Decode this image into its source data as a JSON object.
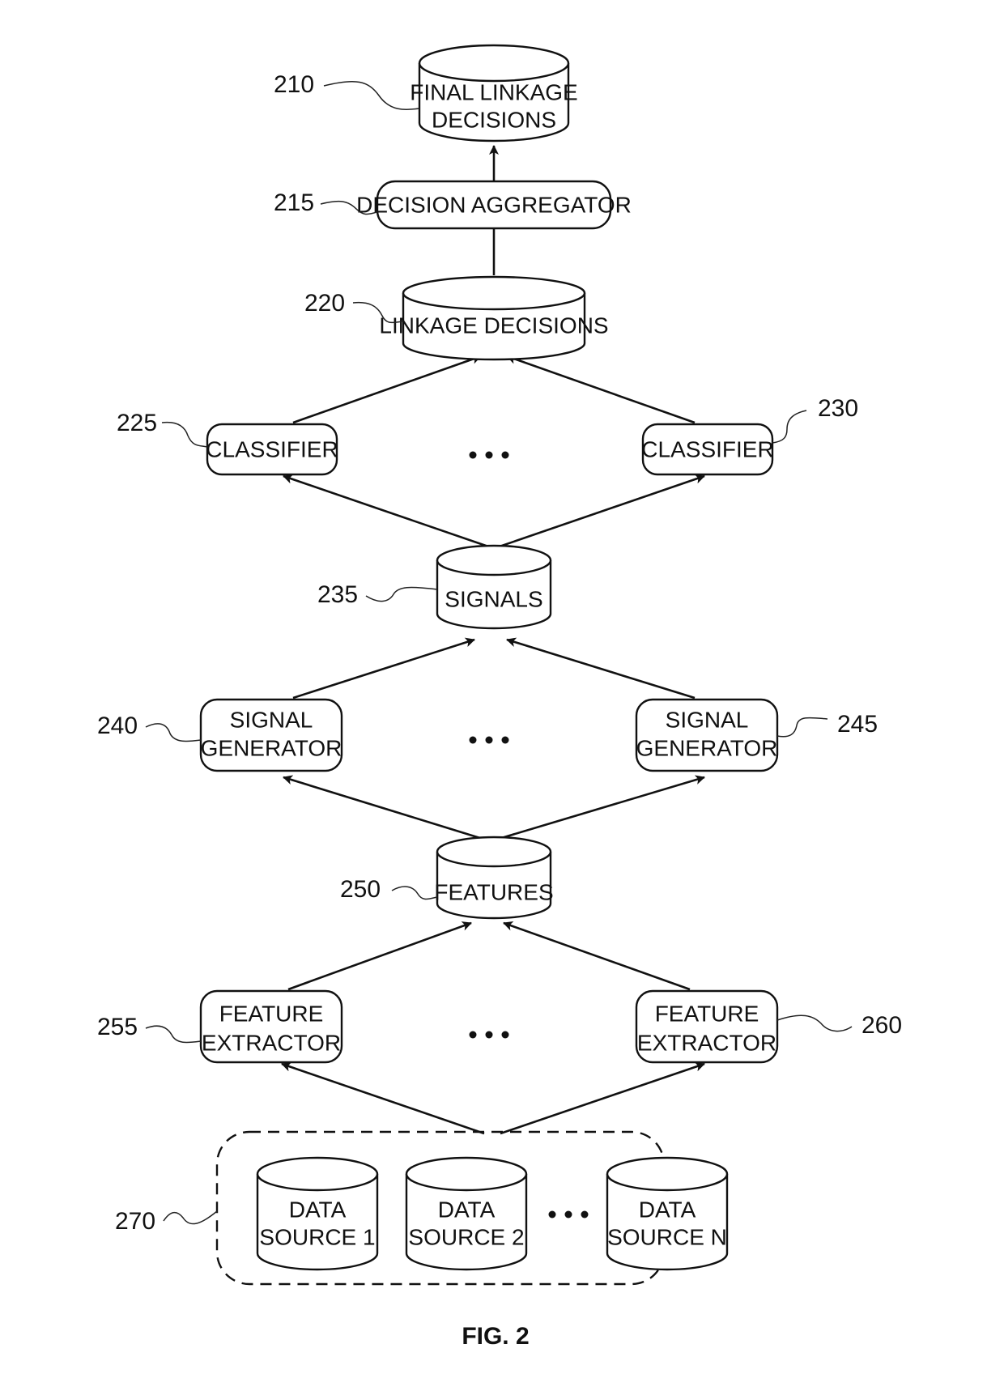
{
  "figure": {
    "caption": "FIG. 2",
    "nodes": {
      "final_linkage": {
        "ref": "210",
        "shape": "database-cylinder",
        "lines": [
          "FINAL LINKAGE",
          "DECISIONS"
        ]
      },
      "aggregator": {
        "ref": "215",
        "shape": "rounded-rect",
        "lines": [
          "DECISION AGGREGATOR"
        ]
      },
      "linkage_decisions": {
        "ref": "220",
        "shape": "database-cylinder",
        "lines": [
          "LINKAGE DECISIONS"
        ]
      },
      "classifier_1": {
        "ref": "225",
        "shape": "rounded-rect",
        "lines": [
          "CLASSIFIER"
        ]
      },
      "classifier_n": {
        "ref": "230",
        "shape": "rounded-rect",
        "lines": [
          "CLASSIFIER"
        ]
      },
      "signals": {
        "ref": "235",
        "shape": "database-cylinder",
        "lines": [
          "SIGNALS"
        ]
      },
      "signal_gen_1": {
        "ref": "240",
        "shape": "rounded-rect",
        "lines": [
          "SIGNAL",
          "GENERATOR"
        ]
      },
      "signal_gen_n": {
        "ref": "245",
        "shape": "rounded-rect",
        "lines": [
          "SIGNAL",
          "GENERATOR"
        ]
      },
      "features": {
        "ref": "250",
        "shape": "database-cylinder",
        "lines": [
          "FEATURES"
        ]
      },
      "feature_ext_1": {
        "ref": "255",
        "shape": "rounded-rect",
        "lines": [
          "FEATURE",
          "EXTRACTOR"
        ]
      },
      "feature_ext_n": {
        "ref": "260",
        "shape": "rounded-rect",
        "lines": [
          "FEATURE",
          "EXTRACTOR"
        ]
      },
      "data_sources": {
        "ref": "270",
        "shape": "dashed-group",
        "items": [
          {
            "lines": [
              "DATA",
              "SOURCE 1"
            ]
          },
          {
            "lines": [
              "DATA",
              "SOURCE 2"
            ]
          },
          {
            "lines": [
              "DATA",
              "SOURCE N"
            ]
          }
        ]
      }
    },
    "edges": [
      {
        "from": "aggregator",
        "to": "final_linkage"
      },
      {
        "from": "linkage_decisions",
        "to": "aggregator"
      },
      {
        "from": "classifier_1",
        "to": "linkage_decisions"
      },
      {
        "from": "classifier_n",
        "to": "linkage_decisions"
      },
      {
        "from": "signals",
        "to": "classifier_1"
      },
      {
        "from": "signals",
        "to": "classifier_n"
      },
      {
        "from": "signal_gen_1",
        "to": "signals"
      },
      {
        "from": "signal_gen_n",
        "to": "signals"
      },
      {
        "from": "features",
        "to": "signal_gen_1"
      },
      {
        "from": "features",
        "to": "signal_gen_n"
      },
      {
        "from": "feature_ext_1",
        "to": "features"
      },
      {
        "from": "feature_ext_n",
        "to": "features"
      },
      {
        "from": "data_sources",
        "to": "feature_ext_1"
      },
      {
        "from": "data_sources",
        "to": "feature_ext_n"
      }
    ],
    "ellipsis_marks": [
      "classifiers",
      "signal-generators",
      "feature-extractors",
      "data-sources"
    ]
  }
}
